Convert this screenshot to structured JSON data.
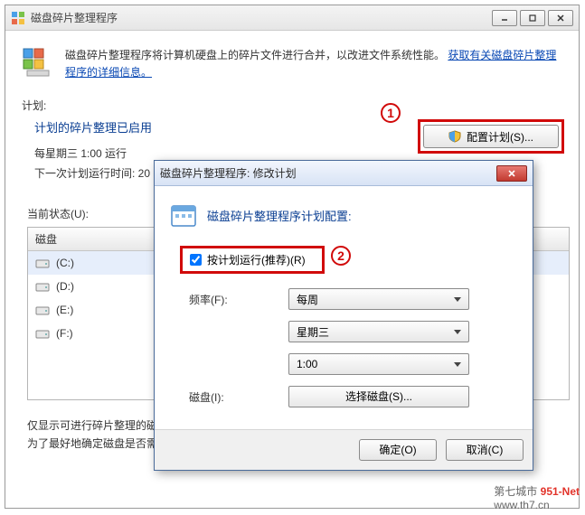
{
  "main_window": {
    "title": "磁盘碎片整理程序",
    "info_text_prefix": "磁盘碎片整理程序将计算机硬盘上的碎片文件进行合并，以改进文件系统性能。",
    "info_link": "获取有关磁盘碎片整理程序的详细信息。",
    "schedule_label": "计划:",
    "schedule_title": "计划的碎片整理已启用",
    "schedule_lines": [
      "每星期三  1:00 运行",
      "下一次计划运行时间: 20"
    ],
    "config_button": "配置计划(S)...",
    "current_state_label": "当前状态(U):",
    "grid_header": "磁盘",
    "drives": [
      "(C:)",
      "(D:)",
      "(E:)",
      "(F:)"
    ],
    "note_lines": [
      "仅显示可进行碎片整理的磁",
      "为了最好地确定磁盘是否需"
    ]
  },
  "callouts": {
    "one": "1",
    "two": "2"
  },
  "modal": {
    "title": "磁盘碎片整理程序: 修改计划",
    "head": "磁盘碎片整理程序计划配置:",
    "checkbox_label": "按计划运行(推荐)(R)",
    "checkbox_checked": true,
    "freq_label": "频率(F):",
    "freq_value": "每周",
    "day_value": "星期三",
    "time_value": "1:00",
    "disk_label": "磁盘(I):",
    "select_disk_btn": "选择磁盘(S)...",
    "ok": "确定(O)",
    "cancel": "取消(C)"
  },
  "watermark": {
    "l1_a": "第七城市",
    "l1_b": "951-Net",
    "l2": "www.th7.cn"
  }
}
